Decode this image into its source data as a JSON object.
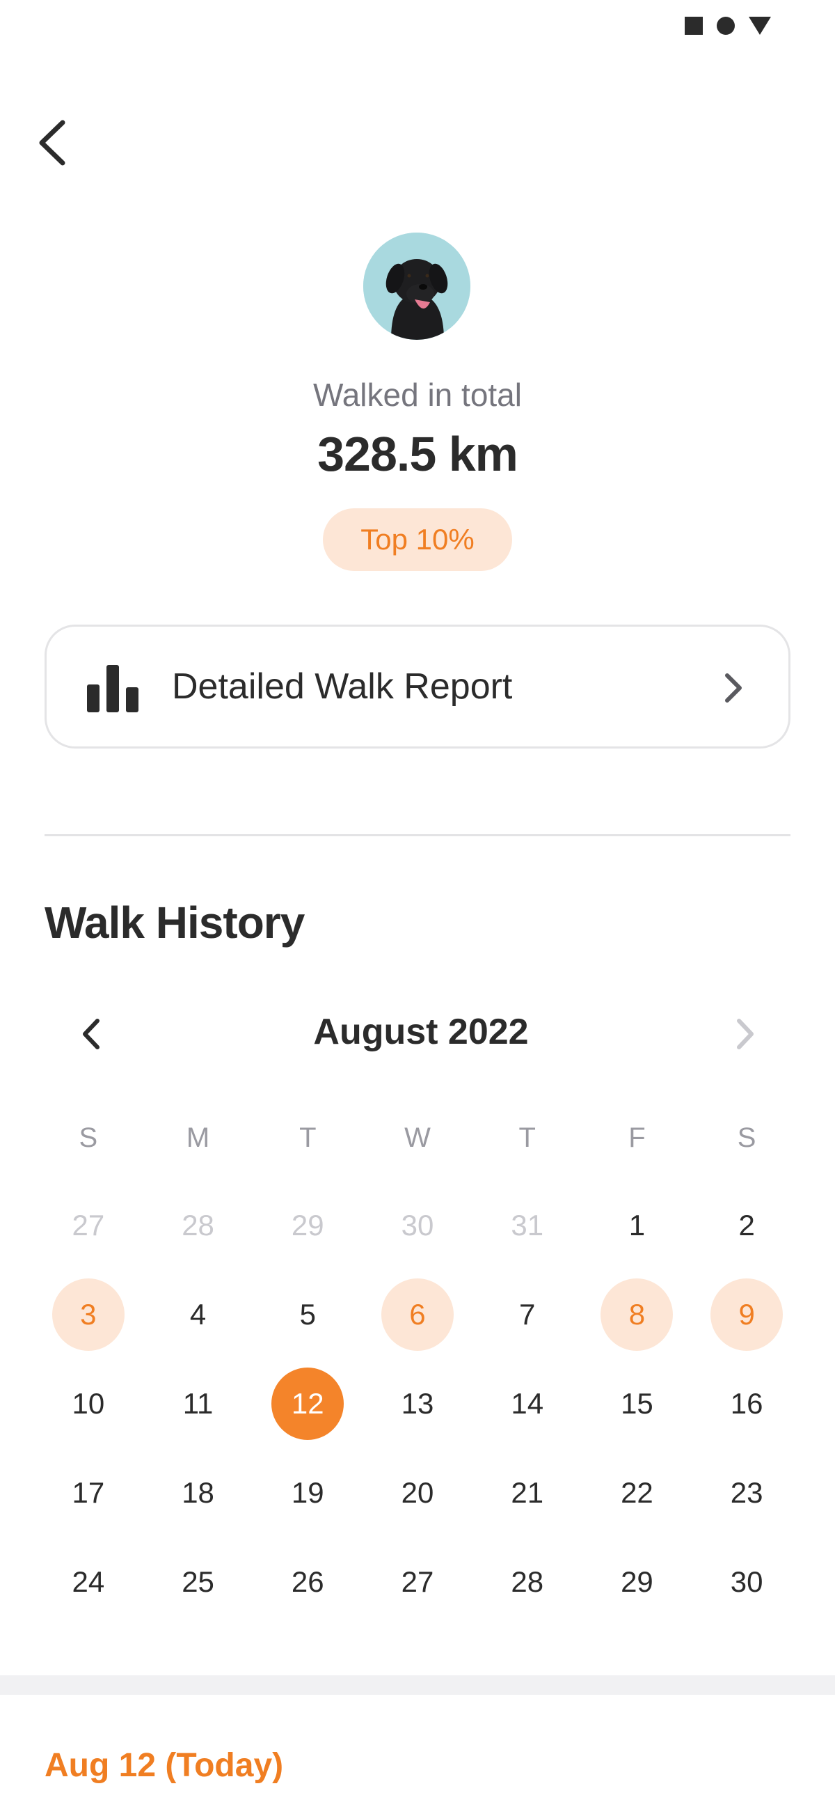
{
  "status_bar": {
    "icons": [
      "square-icon",
      "circle-icon",
      "triangle-icon"
    ]
  },
  "summary": {
    "label": "Walked in total",
    "total": "328.5 km",
    "rank": "Top 10%"
  },
  "report": {
    "label": "Detailed Walk Report",
    "icon": "bar-chart-icon"
  },
  "history": {
    "title": "Walk History",
    "month": "August 2022",
    "weekdays": [
      "S",
      "M",
      "T",
      "W",
      "T",
      "F",
      "S"
    ],
    "days": [
      {
        "d": "27",
        "s": "muted"
      },
      {
        "d": "28",
        "s": "muted"
      },
      {
        "d": "29",
        "s": "muted"
      },
      {
        "d": "30",
        "s": "muted"
      },
      {
        "d": "31",
        "s": "muted"
      },
      {
        "d": "1",
        "s": ""
      },
      {
        "d": "2",
        "s": ""
      },
      {
        "d": "3",
        "s": "walked"
      },
      {
        "d": "4",
        "s": ""
      },
      {
        "d": "5",
        "s": ""
      },
      {
        "d": "6",
        "s": "walked"
      },
      {
        "d": "7",
        "s": ""
      },
      {
        "d": "8",
        "s": "walked"
      },
      {
        "d": "9",
        "s": "walked"
      },
      {
        "d": "10",
        "s": ""
      },
      {
        "d": "11",
        "s": ""
      },
      {
        "d": "12",
        "s": "today"
      },
      {
        "d": "13",
        "s": ""
      },
      {
        "d": "14",
        "s": ""
      },
      {
        "d": "15",
        "s": ""
      },
      {
        "d": "16",
        "s": ""
      },
      {
        "d": "17",
        "s": ""
      },
      {
        "d": "18",
        "s": ""
      },
      {
        "d": "19",
        "s": ""
      },
      {
        "d": "20",
        "s": ""
      },
      {
        "d": "21",
        "s": ""
      },
      {
        "d": "22",
        "s": ""
      },
      {
        "d": "23",
        "s": ""
      },
      {
        "d": "24",
        "s": ""
      },
      {
        "d": "25",
        "s": ""
      },
      {
        "d": "26",
        "s": ""
      },
      {
        "d": "27",
        "s": ""
      },
      {
        "d": "28",
        "s": ""
      },
      {
        "d": "29",
        "s": ""
      },
      {
        "d": "30",
        "s": ""
      }
    ],
    "selected_label": "Aug 12 (Today)"
  },
  "colors": {
    "accent": "#f4842a",
    "accent_soft": "#fde6d6",
    "text": "#2b2b2b",
    "muted": "#c9c9ce"
  }
}
